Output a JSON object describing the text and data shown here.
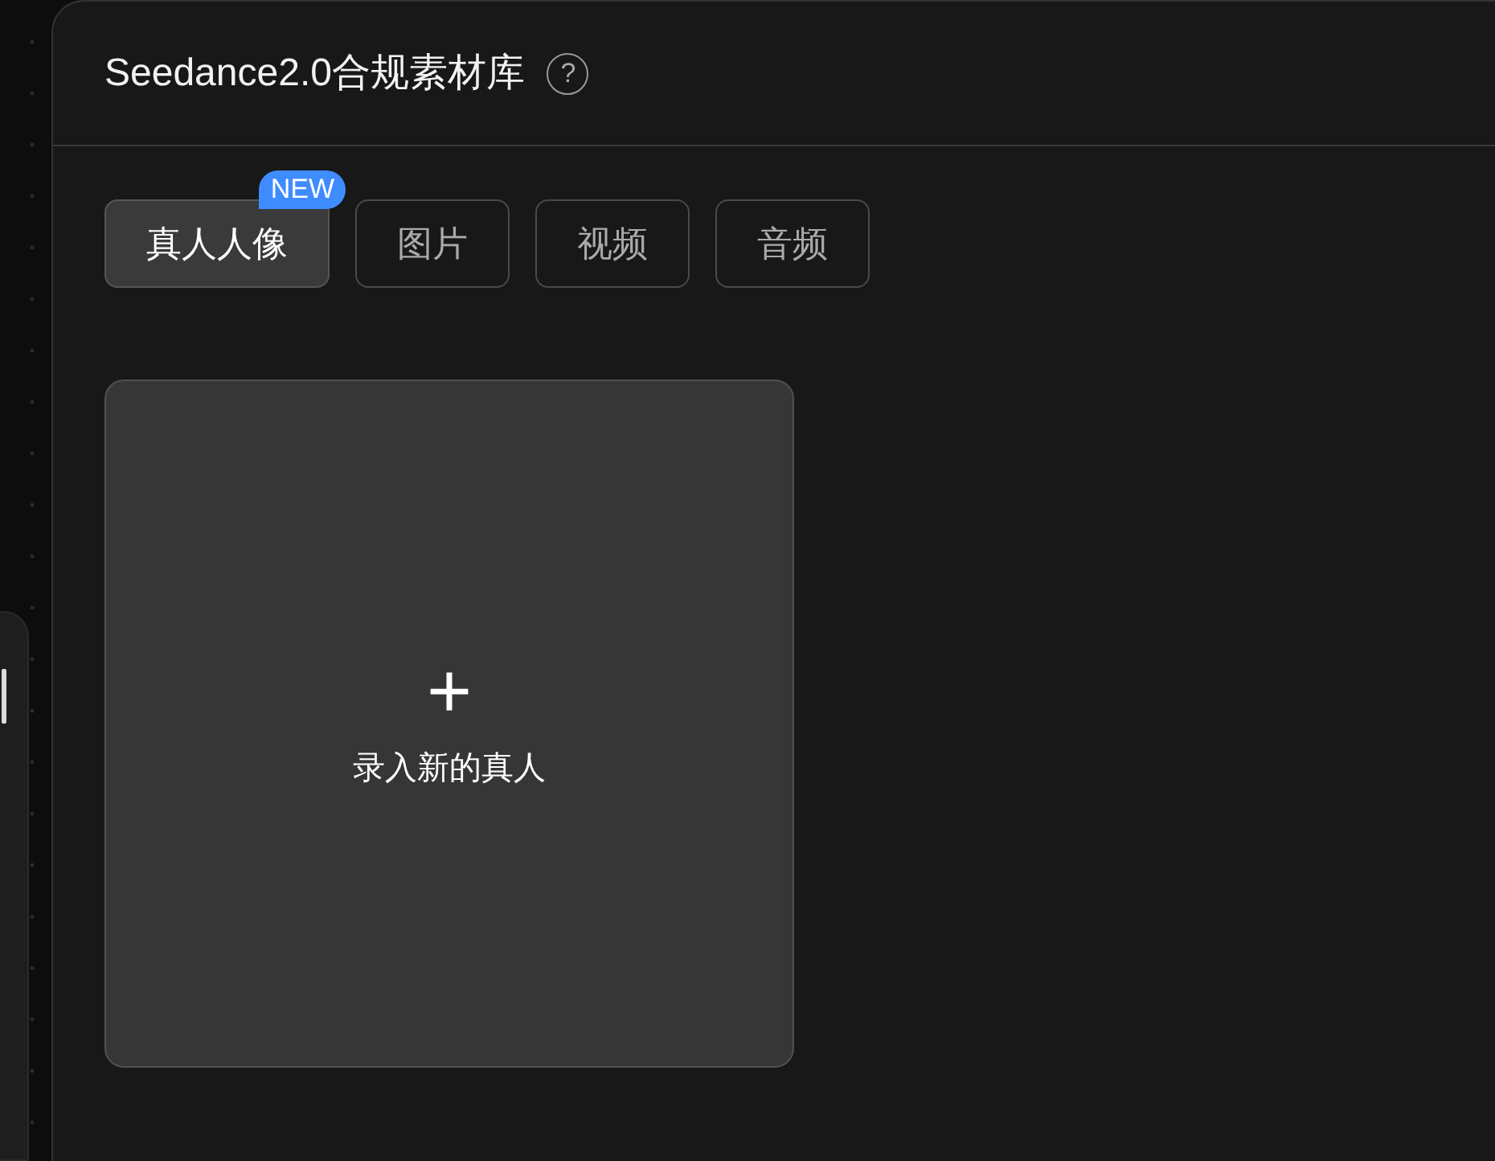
{
  "panel": {
    "title": "Seedance2.0合规素材库",
    "help_icon": "?"
  },
  "tabs": [
    {
      "label": "真人人像",
      "selected": true,
      "badge": "NEW"
    },
    {
      "label": "图片",
      "selected": false
    },
    {
      "label": "视频",
      "selected": false
    },
    {
      "label": "音频",
      "selected": false
    }
  ],
  "add_card": {
    "icon": "+",
    "label": "录入新的真人"
  }
}
